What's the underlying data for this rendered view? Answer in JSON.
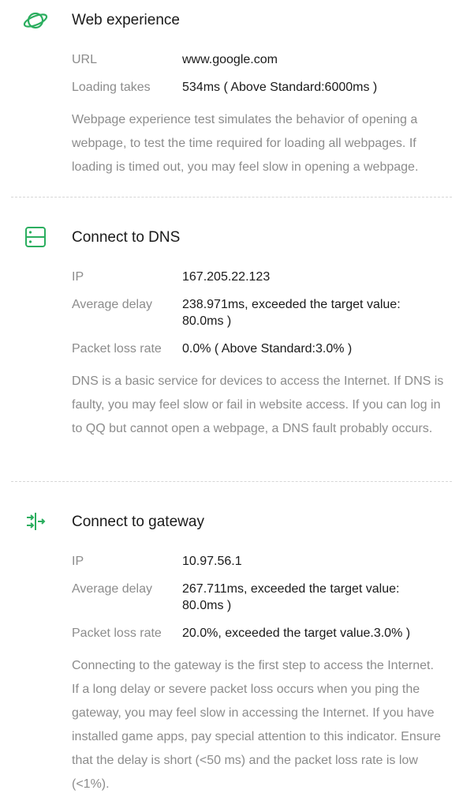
{
  "web": {
    "title": "Web experience",
    "icon": "planet-icon",
    "url_label": "URL",
    "url_value": "www.google.com",
    "loading_label": "Loading takes",
    "loading_value": "534ms ( Above Standard:6000ms )",
    "description": "Webpage experience test simulates the behavior of opening a webpage, to test the time required for loading all webpages. If loading is timed out, you may feel slow in opening a webpage."
  },
  "dns": {
    "title": "Connect to DNS",
    "icon": "server-icon",
    "ip_label": "IP",
    "ip_value": "167.205.22.123",
    "delay_label": "Average delay",
    "delay_value": "238.971ms, exceeded the target value: 80.0ms )",
    "loss_label": "Packet loss rate",
    "loss_value": "0.0% ( Above Standard:3.0% )",
    "description": "DNS is a basic service for devices to access the Internet. If DNS is faulty, you may feel slow or fail in website access. If you can log in to QQ but cannot open a webpage, a DNS fault probably occurs."
  },
  "gateway": {
    "title": "Connect to gateway",
    "icon": "gateway-arrows-icon",
    "ip_label": "IP",
    "ip_value": "10.97.56.1",
    "delay_label": "Average delay",
    "delay_value": "267.711ms, exceeded the target value: 80.0ms )",
    "loss_label": "Packet loss rate",
    "loss_value": "20.0%, exceeded the target value.3.0% )",
    "description": "Connecting to the gateway is the first step to access the Internet. If a long delay or severe packet loss occurs when you ping the gateway, you may feel slow in accessing the Internet. If you have installed game apps, pay special attention to this indicator. Ensure that the delay is short (<50 ms) and the packet loss rate is low (<1%)."
  },
  "colors": {
    "accent": "#2bae5f",
    "label": "#8c8c8c",
    "text": "#1a1a1a",
    "divider": "#d6d6d6"
  }
}
